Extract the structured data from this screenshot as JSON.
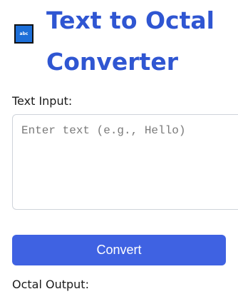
{
  "header": {
    "logo_text": "abc",
    "title": "Text to Octal Converter"
  },
  "input": {
    "label": "Text Input:",
    "placeholder": "Enter text (e.g., Hello)",
    "value": ""
  },
  "actions": {
    "convert_label": "Convert"
  },
  "output": {
    "label": "Octal Output:"
  },
  "colors": {
    "title": "#2f56d2",
    "button": "#3f62e2",
    "logo_background": "#1d6fd8"
  }
}
